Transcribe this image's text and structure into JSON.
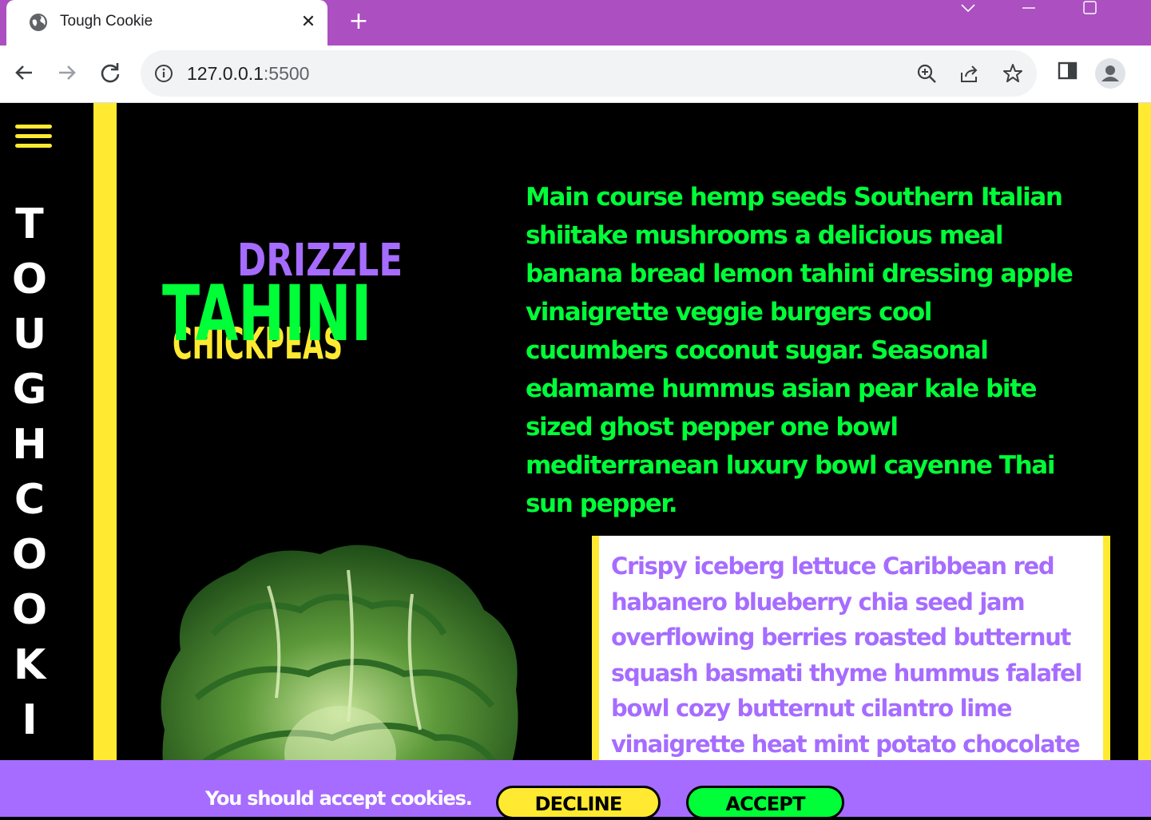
{
  "browser": {
    "tab_title": "Tough Cookie",
    "url_host": "127.0.0.1",
    "url_port": ":5500"
  },
  "site": {
    "vertical_title": [
      "T",
      "O",
      "U",
      "G",
      "H",
      " ",
      "C",
      "O",
      "O",
      "K",
      "I"
    ],
    "headline_words": {
      "drizzle": "DRIZZLE",
      "tahini": "TAHINI",
      "chickpeas": "CHICKPEAS"
    },
    "intro_paragraph": "Main course hemp seeds Southern Italian shiitake mushrooms a delicious meal banana bread lemon tahini dressing apple vinaigrette veggie burgers cool cucumbers coconut sugar. Seasonal edamame hummus asian pear kale bite sized ghost pepper one bowl mediterranean luxury bowl cayenne Thai sun pepper.",
    "card_paragraph": "Crispy iceberg lettuce Caribbean red habanero blueberry chia seed jam overflowing berries roasted butternut squash basmati thyme hummus falafel bowl cozy butternut cilantro lime vinaigrette heat mint potato chocolate",
    "colors": {
      "yellow": "#ffea31",
      "green": "#00ff38",
      "purple": "#a66cff",
      "browser_frame": "#ab4fc1"
    }
  },
  "cookie_banner": {
    "message": "You should accept cookies.",
    "decline_label": "DECLINE",
    "accept_label": "ACCEPT"
  }
}
